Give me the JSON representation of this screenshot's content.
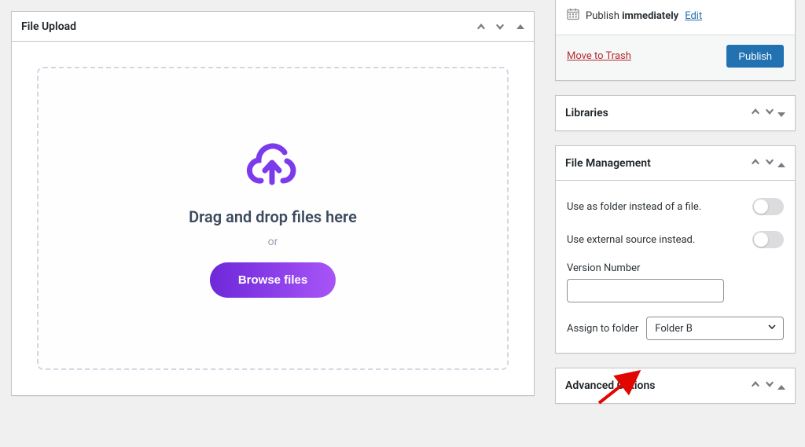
{
  "main": {
    "title": "File Upload",
    "dropzone": {
      "title": "Drag and drop files here",
      "or": "or",
      "browse": "Browse files"
    }
  },
  "sidebar": {
    "publish": {
      "schedule_prefix": "Publish",
      "schedule_strong": "immediately",
      "edit_label": "Edit",
      "trash_label": "Move to Trash",
      "publish_label": "Publish"
    },
    "libraries": {
      "title": "Libraries"
    },
    "file_management": {
      "title": "File Management",
      "use_as_folder_label": "Use as folder instead of a file.",
      "use_external_label": "Use external source instead.",
      "version_label": "Version Number",
      "version_value": "",
      "assign_label": "Assign to folder",
      "assign_value": "Folder B"
    },
    "advanced": {
      "title": "Advanced Options"
    }
  }
}
